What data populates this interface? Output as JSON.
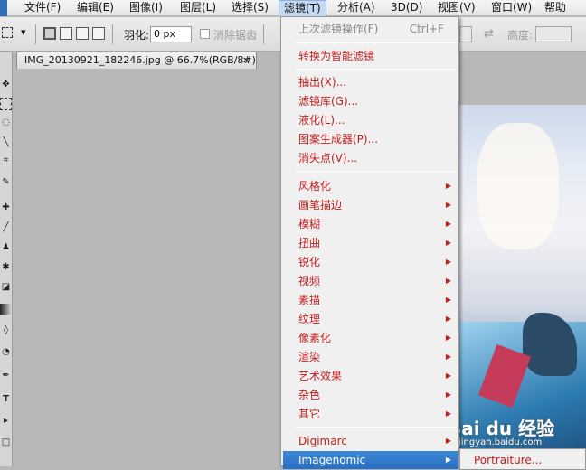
{
  "menubar": {
    "items": [
      {
        "label": "文件(F)"
      },
      {
        "label": "编辑(E)"
      },
      {
        "label": "图像(I)"
      },
      {
        "label": "图层(L)"
      },
      {
        "label": "选择(S)"
      },
      {
        "label": "滤镜(T)"
      },
      {
        "label": "分析(A)"
      },
      {
        "label": "3D(D)"
      },
      {
        "label": "视图(V)"
      },
      {
        "label": "窗口(W)"
      },
      {
        "label": "帮助"
      }
    ],
    "active_index": 5
  },
  "options_bar": {
    "feather_label": "羽化:",
    "feather_value": "0 px",
    "antialias_label": "消除锯齿",
    "height_label": "高度:"
  },
  "document_tab": {
    "title": "IMG_20130921_182246.jpg @ 66.7%(RGB/8#)",
    "close_glyph": "×"
  },
  "filter_menu": {
    "last_filter": {
      "label": "上次滤镜操作(F)",
      "shortcut": "Ctrl+F"
    },
    "smart_filter": "转换为智能滤镜",
    "group1": [
      "抽出(X)...",
      "滤镜库(G)...",
      "液化(L)...",
      "图案生成器(P)...",
      "消失点(V)..."
    ],
    "group2": [
      "风格化",
      "画笔描边",
      "模糊",
      "扭曲",
      "锐化",
      "视频",
      "素描",
      "纹理",
      "像素化",
      "渲染",
      "艺术效果",
      "杂色",
      "其它"
    ],
    "group3": [
      "Digimarc",
      "Imagenomic"
    ],
    "highlighted": "Imagenomic"
  },
  "submenu": {
    "item": "Portraiture..."
  },
  "watermark": {
    "main": "Bai du 经验",
    "sub": "jingyan.baidu.com"
  },
  "icons": {
    "submenu_arrow": "▶",
    "dropdown": "▾"
  }
}
